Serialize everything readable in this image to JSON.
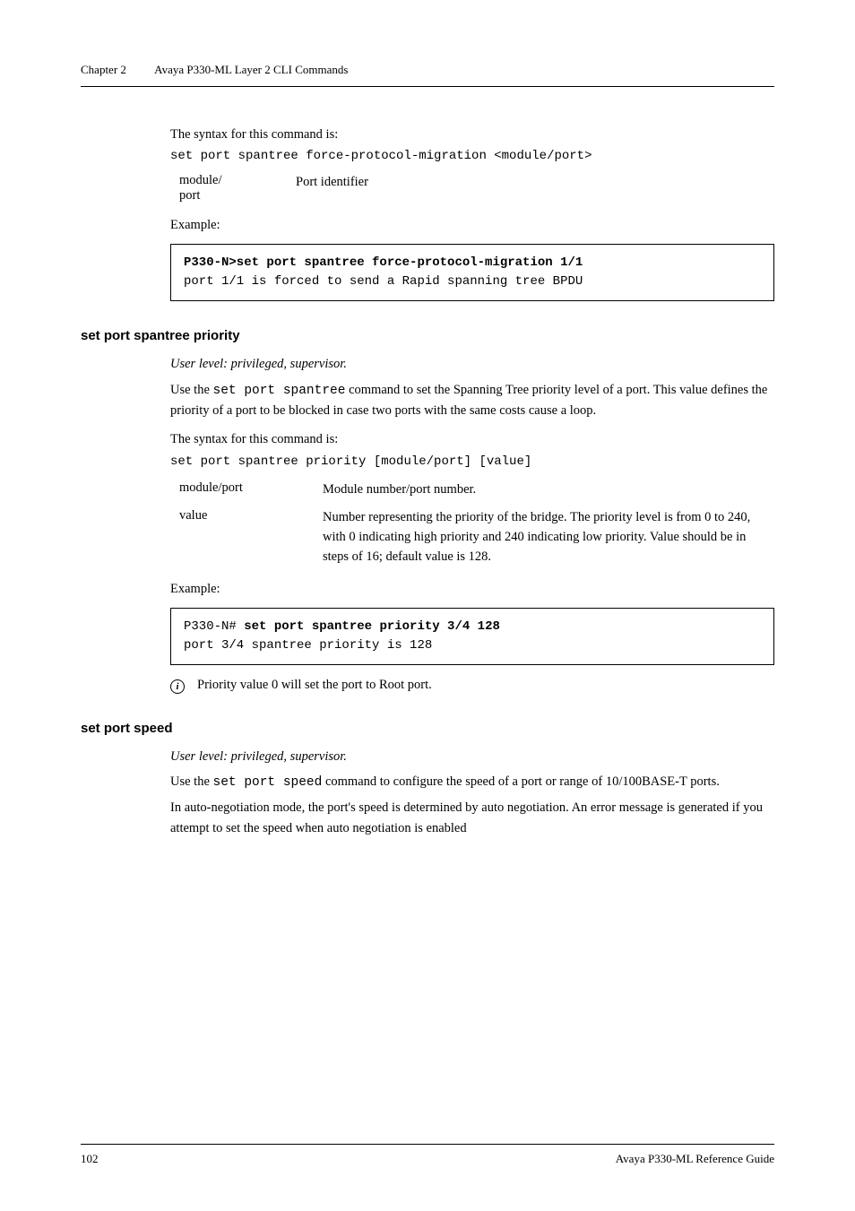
{
  "header": {
    "chapter": "Chapter 2",
    "title": "Avaya P330-ML Layer 2 CLI Commands"
  },
  "block1": {
    "intro": "The syntax for this command is:",
    "syntax": "set port spantree force-protocol-migration <module/port>",
    "param_name": "module/\nport",
    "param_desc": "Port identifier",
    "example_label": "Example:",
    "code_bold": "P330-N>set port spantree force-protocol-migration 1/1",
    "code_out": "port 1/1 is forced to send a Rapid spanning tree BPDU"
  },
  "section2": {
    "title": "set port spantree priority",
    "user_level": "User level: privileged, supervisor.",
    "desc_pre": "Use the ",
    "desc_code": "set port spantree",
    "desc_post": " command to set the Spanning Tree priority level of a port. This value defines the priority of a port to be blocked in case two ports with the same costs cause a loop.",
    "syntax_intro": "The syntax for this command is:",
    "syntax": "set port spantree priority [module/port] [value]",
    "p1_name": "module/port",
    "p1_desc": "Module number/port number.",
    "p2_name": "value",
    "p2_desc": "Number representing the priority of the bridge. The priority level is from 0 to 240, with 0 indicating high priority and 240 indicating low priority. Value should be in steps of 16; default value is 128.",
    "example_label": "Example:",
    "code_pre": "P330-N# ",
    "code_bold": "set port spantree priority 3/4 128",
    "code_out": "port 3/4 spantree priority is 128",
    "note": "Priority value 0 will set the port to Root port."
  },
  "section3": {
    "title": "set port speed",
    "user_level": "User level: privileged, supervisor.",
    "desc_pre": "Use the ",
    "desc_code": "set port speed",
    "desc_post": " command to configure the speed of a port or range of 10/100BASE-T ports.",
    "desc2": "In auto-negotiation mode, the port's speed is determined by auto negotiation. An error message is generated if you attempt to set the speed when auto negotiation is enabled"
  },
  "footer": {
    "page": "102",
    "guide": "Avaya P330-ML Reference Guide"
  }
}
